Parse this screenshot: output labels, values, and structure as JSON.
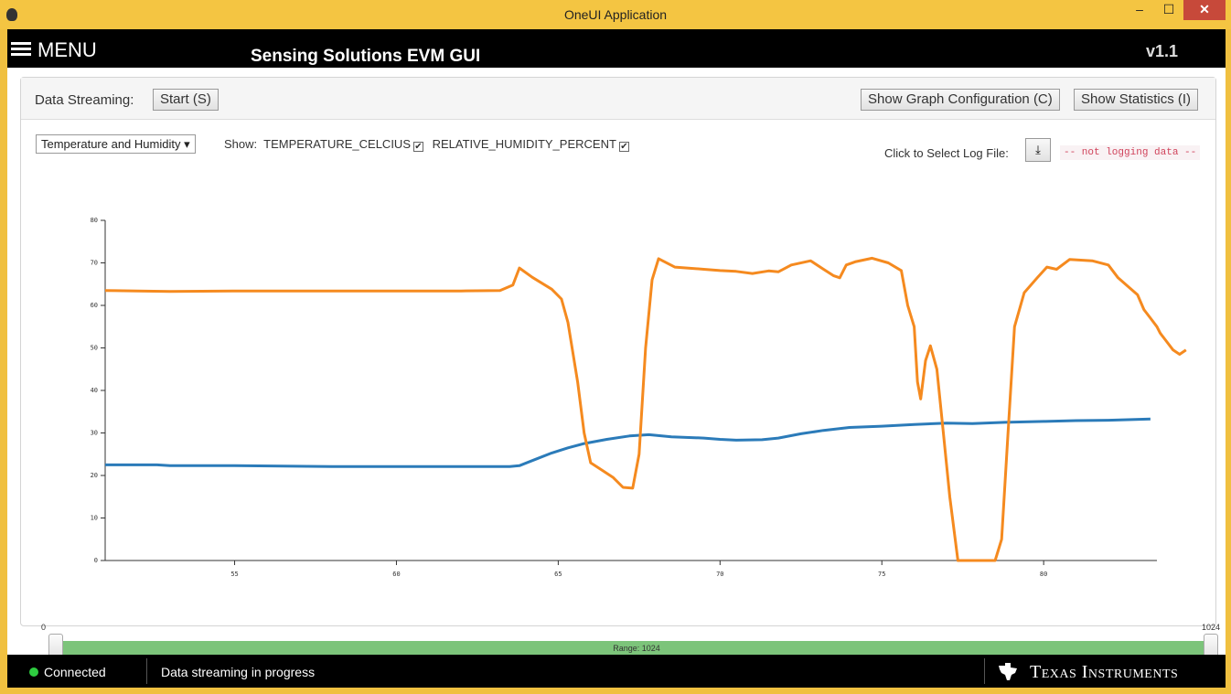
{
  "window": {
    "title": "OneUI Application",
    "min": "–",
    "max": "☐",
    "close": "✕"
  },
  "header": {
    "menu_label": "MENU",
    "app_title": "Sensing Solutions EVM GUI",
    "version": "v1.1"
  },
  "toolbar": {
    "data_streaming_label": "Data Streaming:",
    "start_button": "Start (S)",
    "graph_config_button": "Show Graph Configuration (C)",
    "statistics_button": "Show Statistics (I)"
  },
  "controls": {
    "view_select": "Temperature and Humidity ▾",
    "show_label": "Show:",
    "series_temp": "TEMPERATURE_CELCIUS",
    "series_hum": "RELATIVE_HUMIDITY_PERCENT",
    "log_label": "Click to Select Log File:",
    "log_status": "-- not logging data --"
  },
  "chart_data": {
    "type": "line",
    "ylim": [
      0,
      80
    ],
    "xlim": [
      51,
      83.5
    ],
    "yticks": [
      0,
      10,
      20,
      30,
      40,
      50,
      60,
      70,
      80
    ],
    "xticks": [
      55,
      60,
      65,
      70,
      75,
      80
    ],
    "legend_position": "bottom-left",
    "series": [
      {
        "name": "TEMPERATURE_CELCIUS",
        "color": "#2b7bb9",
        "points": [
          [
            51,
            22.5
          ],
          [
            52.6,
            22.5
          ],
          [
            53,
            22.3
          ],
          [
            55,
            22.3
          ],
          [
            56.5,
            22.2
          ],
          [
            58,
            22.1
          ],
          [
            60,
            22.1
          ],
          [
            62,
            22.1
          ],
          [
            63.5,
            22.1
          ],
          [
            63.8,
            22.3
          ],
          [
            64.3,
            23.8
          ],
          [
            64.8,
            25.3
          ],
          [
            65.3,
            26.5
          ],
          [
            65.8,
            27.5
          ],
          [
            66.5,
            28.5
          ],
          [
            67.2,
            29.3
          ],
          [
            67.8,
            29.6
          ],
          [
            68.5,
            29.1
          ],
          [
            69.5,
            28.8
          ],
          [
            70,
            28.5
          ],
          [
            70.5,
            28.3
          ],
          [
            71.3,
            28.4
          ],
          [
            71.8,
            28.8
          ],
          [
            72.5,
            29.8
          ],
          [
            73.2,
            30.6
          ],
          [
            74,
            31.3
          ],
          [
            75,
            31.6
          ],
          [
            76,
            32.0
          ],
          [
            77,
            32.3
          ],
          [
            77.8,
            32.2
          ],
          [
            78.8,
            32.5
          ],
          [
            80,
            32.7
          ],
          [
            81,
            32.9
          ],
          [
            82,
            33.0
          ],
          [
            83.3,
            33.3
          ]
        ]
      },
      {
        "name": "RELATIVE_HUMIDITY_PERCENT",
        "color": "#f58a1f",
        "points": [
          [
            51,
            63.5
          ],
          [
            52,
            63.4
          ],
          [
            53,
            63.3
          ],
          [
            55,
            63.4
          ],
          [
            58,
            63.4
          ],
          [
            60,
            63.4
          ],
          [
            62,
            63.4
          ],
          [
            63.2,
            63.5
          ],
          [
            63.6,
            64.8
          ],
          [
            63.8,
            68.8
          ],
          [
            64.2,
            66.6
          ],
          [
            64.8,
            63.8
          ],
          [
            65.1,
            61.5
          ],
          [
            65.3,
            56
          ],
          [
            65.6,
            42
          ],
          [
            65.8,
            30
          ],
          [
            66.0,
            23
          ],
          [
            66.3,
            21.5
          ],
          [
            66.7,
            19.5
          ],
          [
            67.0,
            17.2
          ],
          [
            67.3,
            17.0
          ],
          [
            67.5,
            25
          ],
          [
            67.7,
            50
          ],
          [
            67.9,
            66
          ],
          [
            68.1,
            71
          ],
          [
            68.6,
            69
          ],
          [
            69.5,
            68.5
          ],
          [
            70,
            68.2
          ],
          [
            70.5,
            68.0
          ],
          [
            71,
            67.5
          ],
          [
            71.5,
            68.1
          ],
          [
            71.8,
            67.9
          ],
          [
            72.2,
            69.5
          ],
          [
            72.8,
            70.5
          ],
          [
            73.2,
            68.5
          ],
          [
            73.5,
            67
          ],
          [
            73.7,
            66.5
          ],
          [
            73.9,
            69.5
          ],
          [
            74.2,
            70.3
          ],
          [
            74.7,
            71.1
          ],
          [
            75.2,
            70.0
          ],
          [
            75.6,
            68.2
          ],
          [
            75.8,
            60
          ],
          [
            76.0,
            55
          ],
          [
            76.1,
            42
          ],
          [
            76.2,
            38
          ],
          [
            76.35,
            47
          ],
          [
            76.5,
            50.5
          ],
          [
            76.7,
            45
          ],
          [
            76.9,
            30
          ],
          [
            77.1,
            15
          ],
          [
            77.35,
            0
          ],
          [
            78.5,
            0
          ],
          [
            78.7,
            5
          ],
          [
            78.9,
            30
          ],
          [
            79.1,
            55
          ],
          [
            79.4,
            63
          ],
          [
            79.8,
            66.5
          ],
          [
            80.1,
            69
          ],
          [
            80.4,
            68.5
          ],
          [
            80.8,
            70.8
          ],
          [
            81.5,
            70.5
          ],
          [
            82.0,
            69.5
          ],
          [
            82.3,
            66.5
          ],
          [
            82.6,
            64.5
          ],
          [
            82.9,
            62.5
          ],
          [
            83.1,
            59
          ],
          [
            83.3,
            57
          ],
          [
            83.5,
            55
          ],
          [
            83.6,
            53.5
          ],
          [
            83.8,
            51.5
          ],
          [
            84.0,
            49.5
          ],
          [
            84.2,
            48.5
          ],
          [
            84.4,
            49.5
          ]
        ]
      }
    ]
  },
  "range": {
    "min_label": "0",
    "max_label": "1024",
    "range_text": "Range: 1024"
  },
  "footer": {
    "status": "Connected",
    "message": "Data streaming in progress",
    "brand": "Texas Instruments"
  }
}
